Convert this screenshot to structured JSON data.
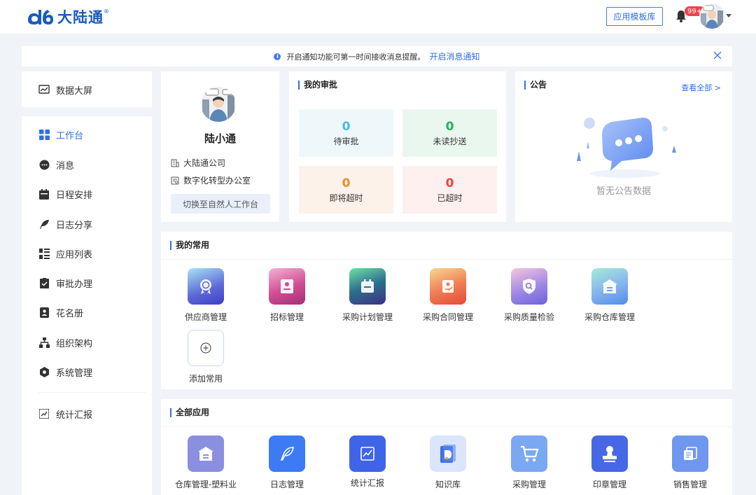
{
  "header": {
    "brand": "大陆通",
    "brand_reg": "®",
    "template_button": "应用模板库",
    "notification_count": "99+"
  },
  "notice": {
    "text": "开启通知功能可第一时间接收消息提醒。",
    "link": "开启消息通知"
  },
  "sidebar": {
    "top_item": "数据大屏",
    "items": [
      {
        "label": "工作台",
        "icon": "grid-icon"
      },
      {
        "label": "消息",
        "icon": "chat-icon"
      },
      {
        "label": "日程安排",
        "icon": "calendar-icon"
      },
      {
        "label": "日志分享",
        "icon": "feather-icon"
      },
      {
        "label": "应用列表",
        "icon": "list-icon"
      },
      {
        "label": "审批办理",
        "icon": "clipboard-icon"
      },
      {
        "label": "花名册",
        "icon": "contacts-icon"
      },
      {
        "label": "组织架构",
        "icon": "org-icon"
      },
      {
        "label": "系统管理",
        "icon": "hexagon-icon"
      }
    ],
    "bottom_item": "统计汇报"
  },
  "profile": {
    "name": "陆小通",
    "company": "大陆通公司",
    "office": "数字化转型办公室",
    "switch_button": "切换至自然人工作台"
  },
  "approval": {
    "title": "我的审批",
    "tiles": [
      {
        "value": "0",
        "label": "待审批",
        "color": "#3fbfe0",
        "bg": "#eef8fb"
      },
      {
        "value": "0",
        "label": "未读抄送",
        "color": "#1fb45c",
        "bg": "#eaf7ee"
      },
      {
        "value": "0",
        "label": "即将超时",
        "color": "#f08a2c",
        "bg": "#fdf2ea"
      },
      {
        "value": "0",
        "label": "已超时",
        "color": "#ee3f3f",
        "bg": "#fdf0ee"
      }
    ]
  },
  "announce": {
    "title": "公告",
    "more": "查看全部 >",
    "empty": "暂无公告数据"
  },
  "common": {
    "title": "我的常用",
    "apps": [
      {
        "label": "供应商管理",
        "icon": "badge-icon"
      },
      {
        "label": "招标管理",
        "icon": "id-card-icon"
      },
      {
        "label": "采购计划管理",
        "icon": "calendar-icon"
      },
      {
        "label": "采购合同管理",
        "icon": "contract-icon"
      },
      {
        "label": "采购质量检验",
        "icon": "shield-search-icon"
      },
      {
        "label": "采购仓库管理",
        "icon": "warehouse-icon"
      }
    ],
    "add": "添加常用"
  },
  "all_apps": {
    "title": "全部应用",
    "apps": [
      {
        "label": "仓库管理-塑料业",
        "icon": "warehouse-icon",
        "color": "#8b8fe0"
      },
      {
        "label": "日志管理",
        "icon": "feather-icon",
        "color": "#3d7bf5"
      },
      {
        "label": "统计汇报",
        "icon": "chart-icon",
        "color": "#3f64e8"
      },
      {
        "label": "知识库",
        "icon": "book-icon",
        "color": "#dbe5fb"
      },
      {
        "label": "采购管理",
        "icon": "cart-icon",
        "color": "#7aa8f2"
      },
      {
        "label": "印章管理",
        "icon": "stamp-icon",
        "color": "#4768e6"
      },
      {
        "label": "销售管理",
        "icon": "docs-icon",
        "color": "#6f97ef"
      }
    ]
  }
}
